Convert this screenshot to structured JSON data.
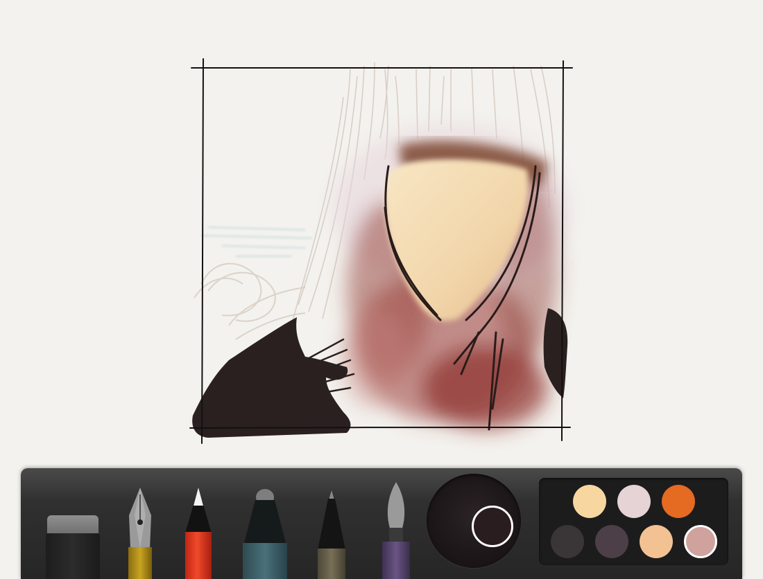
{
  "app": {
    "accent": "#ffffff",
    "paper_color": "#f3f2ee"
  },
  "tools": [
    {
      "id": "eraser",
      "icon": "eraser-icon"
    },
    {
      "id": "fountain-pen",
      "icon": "fountain-pen-icon",
      "color": "#c9a421"
    },
    {
      "id": "pencil",
      "icon": "pencil-icon",
      "color": "#ef4a2a"
    },
    {
      "id": "marker",
      "icon": "marker-icon",
      "color": "#4b7079"
    },
    {
      "id": "fine-pen",
      "icon": "fine-pen-icon",
      "color": "#786f56"
    },
    {
      "id": "brush",
      "icon": "brush-icon",
      "color": "#6a5485"
    }
  ],
  "current_color": "#2a1d20",
  "palette": {
    "swatches": [
      {
        "color": "#f7d79f",
        "selected": false
      },
      {
        "color": "#e5d3d5",
        "selected": false
      },
      {
        "color": "#e56a22",
        "selected": false
      },
      {
        "color": "#3a3536",
        "selected": false
      },
      {
        "color": "#4c3f47",
        "selected": false
      },
      {
        "color": "#f3c293",
        "selected": false
      },
      {
        "color": "#cfa29d",
        "selected": true
      }
    ]
  }
}
